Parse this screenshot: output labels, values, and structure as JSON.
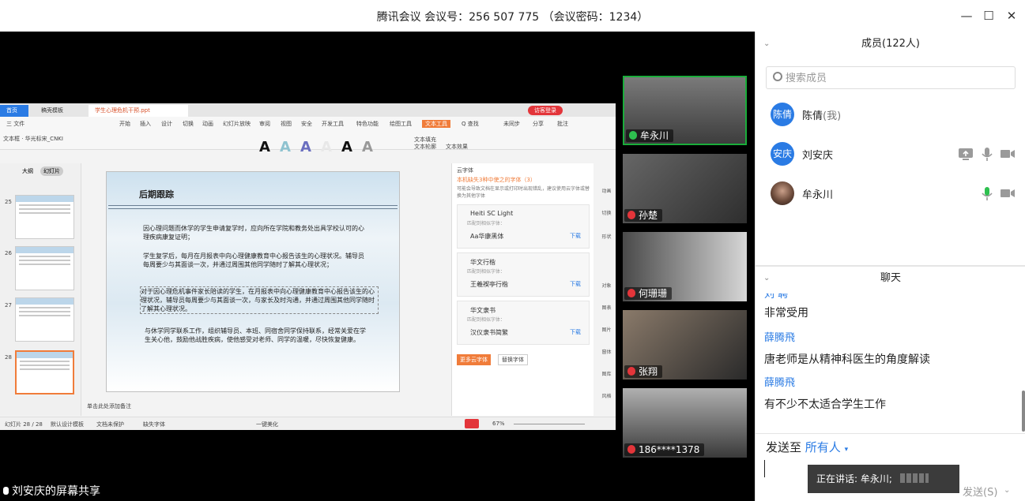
{
  "title_bar": {
    "title": "腾讯会议 会议号：256 507 775 （会议密码：1234）",
    "minimize": "—",
    "maximize": "☐",
    "close": "✕"
  },
  "share": {
    "caption": "刘安庆的屏幕共享",
    "wps": {
      "tabs": [
        "首页",
        "稿壳模板",
        "学生心理危机干预.ppt"
      ],
      "login": "访客登录",
      "menu": [
        "三 文件",
        "开始",
        "插入",
        "设计",
        "切换",
        "动画",
        "幻灯片放映",
        "审阅",
        "视图",
        "安全",
        "开发工具",
        "特色功能",
        "绘图工具",
        "文本工具",
        "Q 查找"
      ],
      "share_buttons": [
        "未同步",
        "分享",
        "批注"
      ],
      "ribbon_row2": "文本框 · 华光标宋_CNKI",
      "wordart": [
        "A",
        "A",
        "A",
        "A",
        "A",
        "A"
      ],
      "text_fill": "文本填充",
      "text_outline": "文本轮廓",
      "text_effect": "文本效果",
      "thumbs_tabs": [
        "大纲",
        "幻灯片"
      ],
      "thumb_numbers": [
        "25",
        "26",
        "27",
        "28"
      ],
      "slide": {
        "title": "后期跟踪",
        "p1": "因心理问题而休学的学生申请复学时，应向所在学院和教务处出具学校认可的心理疾病康复证明；",
        "p2": "学生复学后，每月在月报表中向心理健康教育中心报告该生的心理状况。辅导员每周要少与其面谈一次，并通过周围其他同学随时了解其心理状况；",
        "p3": "对于因心理危机事件家长陪读的学生，在月报表中向心理健康教育中心报告该生的心理状况，辅导员每周要少与其面谈一次，与家长及时沟通，并通过周围其他同学随时了解其心理状况。",
        "p4": "与休学同学联系工作，组织辅导员、本班、同宿舍同学保持联系，经常关爱在学生关心他，鼓励他战胜疾病，使他感受对老师、同学的温暖，尽快恢复健康。"
      },
      "notes_hint": "单击此处添加备注",
      "cloudfont": {
        "header": "云字体",
        "warning": "本机缺失3种中使之的字体（3）",
        "desc": "可能会导致文档在显示或打印时出现错乱，建议使用云字体或替换为其他字体",
        "fonts": [
          {
            "name": "Heiti SC Light",
            "sub": "匹配到相似字体：",
            "preview": "Aa华康黑体",
            "action": "下载"
          },
          {
            "name": "华文行楷",
            "sub": "匹配到相似字体：",
            "preview": "王羲褉亭行楷",
            "action": "下载"
          },
          {
            "name": "华文隶书",
            "sub": "匹配到相似字体：",
            "preview": "汉仪隶书简繁",
            "action": "下载"
          }
        ],
        "more_button": "更多云字体",
        "replace_button": "替换字体"
      },
      "right_rail": [
        "动画",
        "切换",
        "形状",
        "对象",
        "图表",
        "图片",
        "窗体",
        "图库",
        "风格"
      ],
      "status": {
        "slide_pos": "幻灯片 28 / 28",
        "template": "默认设计模板",
        "protect": "文档未保护",
        "missing_font": "缺失字体",
        "beautify": "一键美化",
        "zoom": "67%"
      }
    }
  },
  "videos": [
    {
      "name": "牟永川",
      "mic": "on",
      "active": true
    },
    {
      "name": "孙楚",
      "mic": "off",
      "active": false
    },
    {
      "name": "何珊珊",
      "mic": "off",
      "active": false
    },
    {
      "name": "张翔",
      "mic": "off",
      "active": false
    },
    {
      "name": "186****1378",
      "mic": "off",
      "active": false
    }
  ],
  "members": {
    "header": "成员(122人)",
    "search_placeholder": "搜索成员",
    "list": [
      {
        "avatar": "陈倩",
        "name": "陈倩",
        "me": "(我)"
      },
      {
        "avatar": "安庆",
        "name": "刘安庆",
        "me": ""
      },
      {
        "avatar": "",
        "name": "牟永川",
        "me": ""
      }
    ]
  },
  "chat": {
    "header": "聊天",
    "messages": [
      {
        "sender": "刘 聘",
        "text": "非常受用"
      },
      {
        "sender": "薛腾飛",
        "text": "唐老师是从精神科医生的角度解读"
      },
      {
        "sender": "薛腾飛",
        "text": "有不少不太适合学生工作"
      }
    ],
    "send_to_label": "发送至",
    "send_to_target": "所有人",
    "send_button": "发送(S)"
  },
  "speaking": "正在讲话: 牟永川;",
  "colors": {
    "accent": "#2a7be4",
    "mic_on": "#2ec04f",
    "mic_off": "#e3353a",
    "active_border": "#1aad3a"
  }
}
